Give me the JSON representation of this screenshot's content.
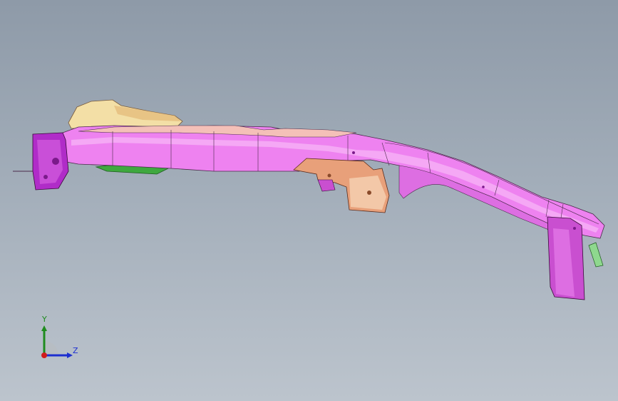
{
  "viewport": {
    "background_top": "#8e9aa8",
    "background_bottom": "#bcc4cd"
  },
  "model": {
    "part_colors": {
      "rail": "#ee82f0",
      "rail_light": "#f6b2f6",
      "rail_dark": "#c94fd0",
      "end_cap": "#b02cc8",
      "bracket": "#e8a07a",
      "bracket_light": "#f3c8a8",
      "top_cover": "#f3dfa6",
      "bottom_panel": "#3fa83f",
      "clip": "#8ed88e",
      "edge": "#4a2a4a"
    }
  },
  "triad": {
    "y_label": "Y",
    "z_label": "Z",
    "y_color": "#1f8c1f",
    "z_color": "#1c2fd0",
    "x_color": "#d01c1c"
  }
}
